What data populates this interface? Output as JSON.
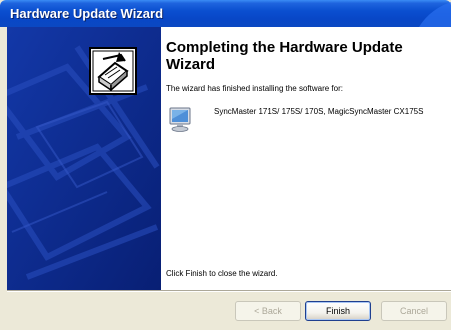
{
  "window": {
    "title": "Hardware Update Wizard"
  },
  "main": {
    "heading": "Completing the Hardware Update Wizard",
    "intro": "The wizard has finished installing the software for:",
    "device_name": "SyncMaster 171S/ 175S/ 170S, MagicSyncMaster CX175S",
    "finish_note": "Click Finish to close the wizard."
  },
  "buttons": {
    "back_label": "< Back",
    "finish_label": "Finish",
    "cancel_label": "Cancel"
  },
  "icons": {
    "wizard": "hardware-wizard-icon",
    "device": "monitor-icon"
  },
  "colors": {
    "titlebar": "#0a4fd0",
    "side_panel": "#0c2c8f",
    "dialog_bg": "#ece9d8"
  }
}
